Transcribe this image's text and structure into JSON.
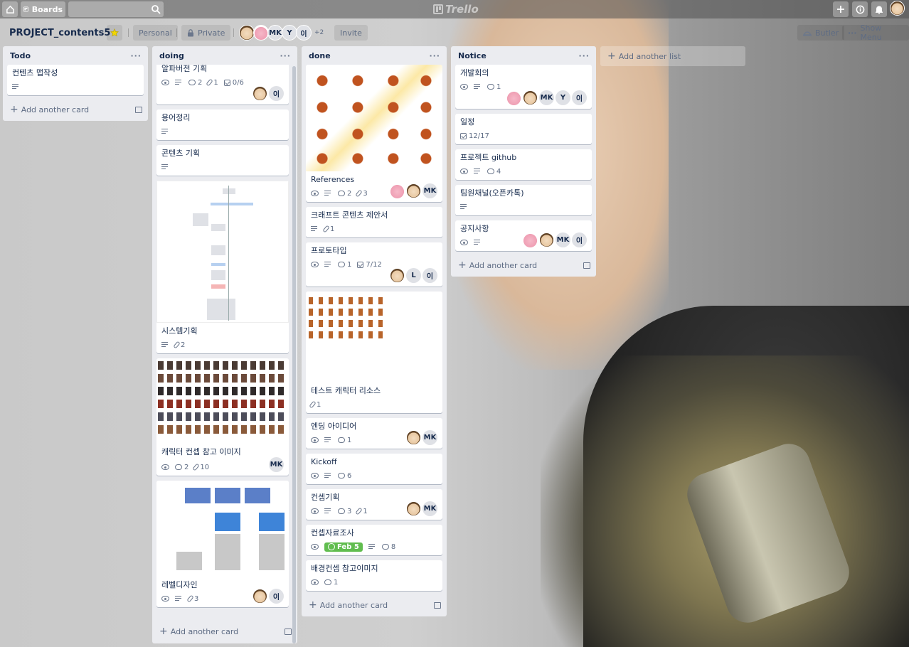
{
  "topbar": {
    "boards_label": "Boards",
    "logo_text": "Trello"
  },
  "board": {
    "title": "PROJECT_contents5",
    "personal_label": "Personal",
    "private_label": "Private",
    "members": [
      "MK",
      "Y",
      "이"
    ],
    "more_members": "+2",
    "invite_label": "Invite",
    "butler_label": "Butler",
    "menu_label": "Show Menu"
  },
  "lists": [
    {
      "title": "Todo",
      "cards": [
        {
          "title": "컨텐츠 맵작성"
        }
      ],
      "add_card": "Add another card"
    },
    {
      "title": "doing",
      "cards": [
        {
          "title": "알파버전 기획",
          "comments": "2",
          "attachments": "1",
          "checklist": "0/6",
          "member": "이"
        },
        {
          "title": "용어정리"
        },
        {
          "title": "콘텐츠 기획"
        },
        {
          "title": "시스템기획",
          "attachments": "2"
        },
        {
          "title": "캐릭터 컨셉 참고 이미지",
          "comments": "2",
          "attachments": "10",
          "member": "MK"
        },
        {
          "title": "레벨디자인",
          "attachments": "3",
          "member": "이"
        }
      ],
      "add_card": "Add another card"
    },
    {
      "title": "done",
      "cards": [
        {
          "title": "References",
          "comments": "2",
          "attachments": "3",
          "member": "MK"
        },
        {
          "title": "크래프트 콘텐츠 제안서",
          "attachments": "1"
        },
        {
          "title": "프로토타입",
          "comments": "1",
          "checklist": "7/12",
          "members": [
            "L",
            "이"
          ]
        },
        {
          "title": "테스트 캐릭터 리소스",
          "attachments": "1"
        },
        {
          "title": "엔딩 아이디어",
          "comments": "1",
          "member": "MK"
        },
        {
          "title": "Kickoff",
          "comments": "6"
        },
        {
          "title": "컨셉기획",
          "comments": "3",
          "attachments": "1",
          "member": "MK"
        },
        {
          "title": "컨셉자료조사",
          "due": "Feb 5",
          "comments": "8"
        },
        {
          "title": "배경컨셉 참고이미지",
          "comments": "1"
        }
      ],
      "add_card": "Add another card"
    },
    {
      "title": "Notice",
      "cards": [
        {
          "title": "개발회의",
          "comments": "1",
          "members": [
            "MK",
            "Y",
            "이"
          ]
        },
        {
          "title": "일정",
          "checklist": "12/17"
        },
        {
          "title": "프로젝트 github",
          "comments": "4"
        },
        {
          "title": "팀원채널(오픈카톡)"
        },
        {
          "title": "공지사항",
          "members": [
            "MK",
            "이"
          ]
        }
      ],
      "add_card": "Add another card"
    }
  ],
  "add_list": "Add another list",
  "colors": {
    "list_bg": "#ebecf0",
    "due_green": "#61bd4f"
  }
}
